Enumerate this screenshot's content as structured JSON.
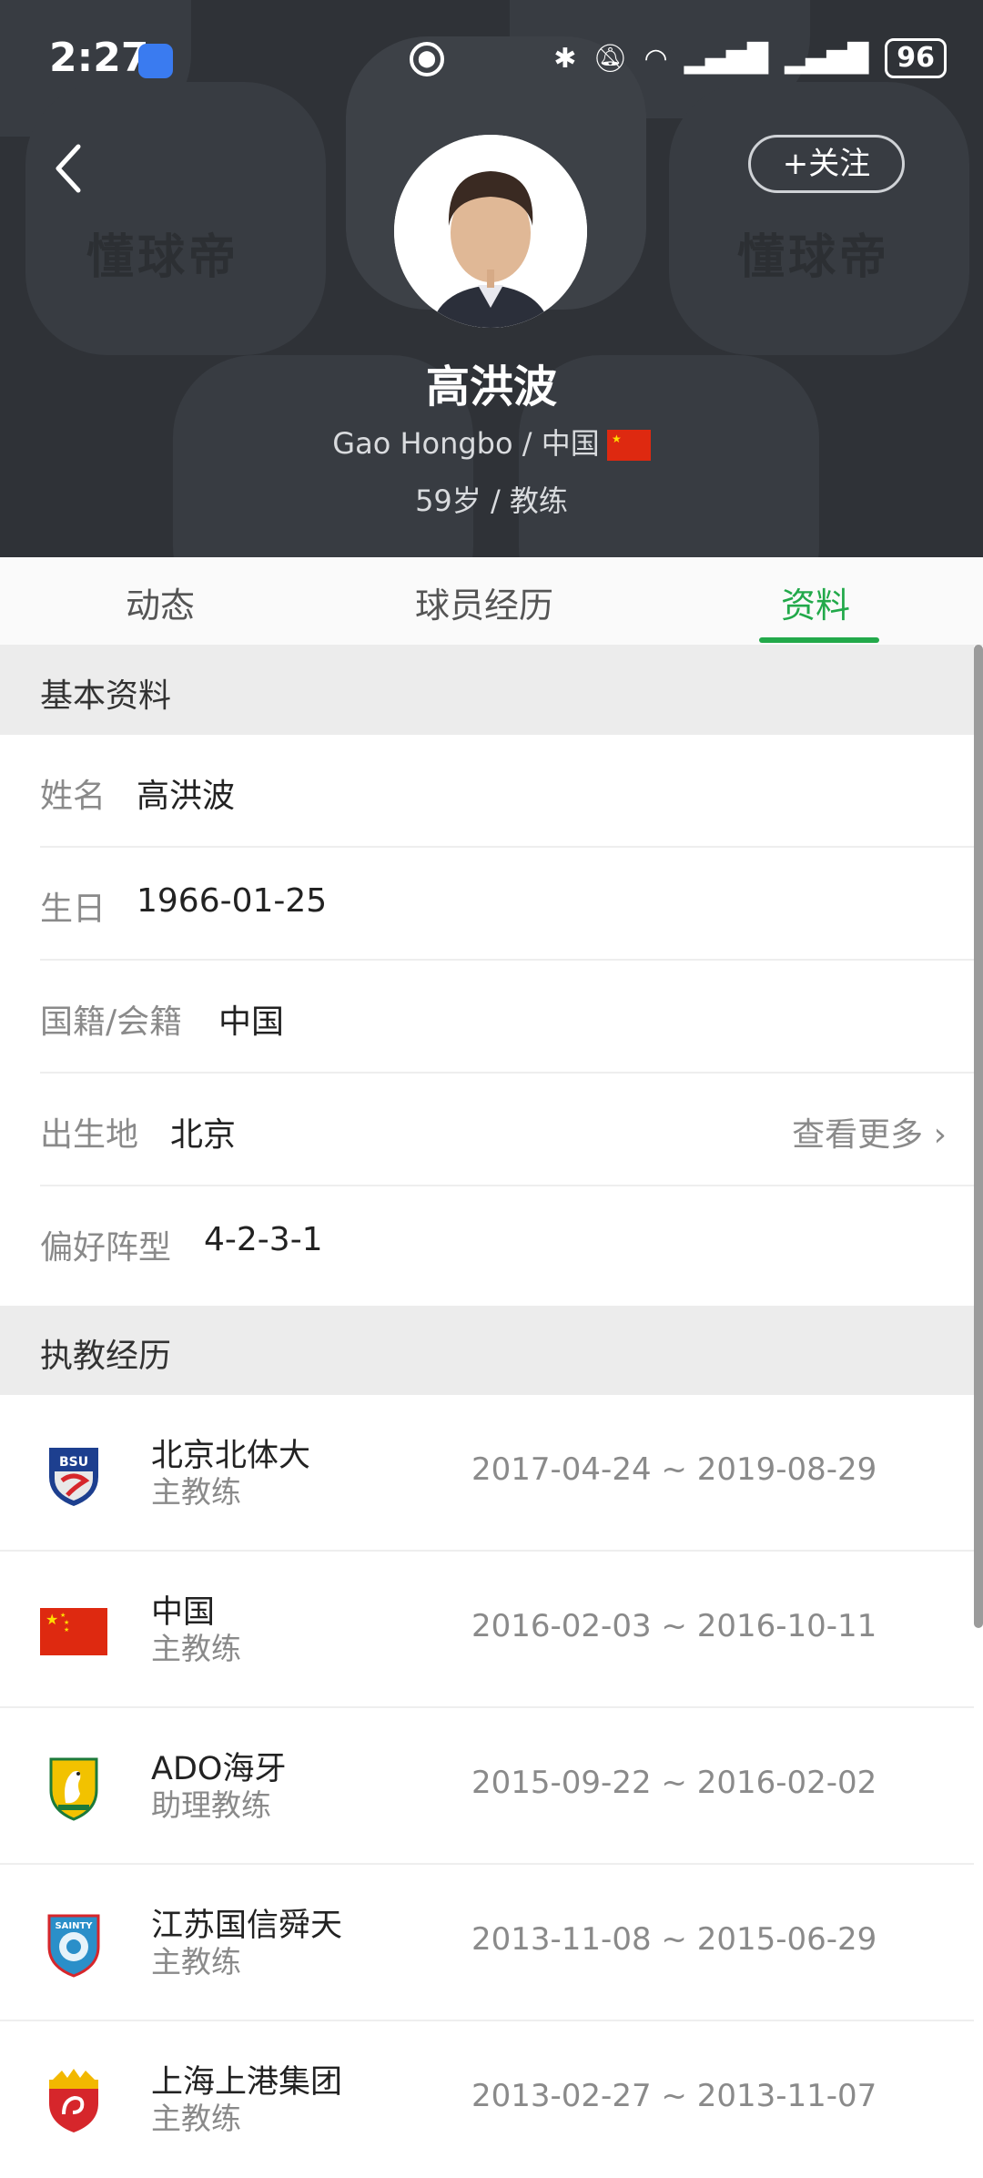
{
  "status_bar": {
    "time": "2:27",
    "battery": "96"
  },
  "header": {
    "follow_label": "+关注",
    "watermark": "懂球帝",
    "name": "高洪波",
    "subtitle": "Gao Hongbo / 中国",
    "meta": "59岁 / 教练"
  },
  "tabs": [
    {
      "label": "动态"
    },
    {
      "label": "球员经历"
    },
    {
      "label": "资料",
      "active": true
    }
  ],
  "basic_info": {
    "section_title": "基本资料",
    "rows": [
      {
        "label": "姓名",
        "value": "高洪波"
      },
      {
        "label": "生日",
        "value": "1966-01-25"
      },
      {
        "label": "国籍/会籍",
        "value": "中国"
      },
      {
        "label": "出生地",
        "value": "北京",
        "more": "查看更多"
      },
      {
        "label": "偏好阵型",
        "value": "4-2-3-1"
      }
    ]
  },
  "coaching": {
    "section_title": "执教经历",
    "items": [
      {
        "team": "北京北体大",
        "role": "主教练",
        "dates": "2017-04-24 ~ 2019-08-29",
        "logo": "bsu-logo",
        "logo_text": "BSU"
      },
      {
        "team": "中国",
        "role": "主教练",
        "dates": "2016-02-03 ~ 2016-10-11",
        "logo": "china-flag"
      },
      {
        "team": "ADO海牙",
        "role": "助理教练",
        "dates": "2015-09-22 ~ 2016-02-02",
        "logo": "ado-logo"
      },
      {
        "team": "江苏国信舜天",
        "role": "主教练",
        "dates": "2013-11-08 ~ 2015-06-29",
        "logo": "sainty-logo",
        "logo_text": "SAINTY"
      },
      {
        "team": "上海上港集团",
        "role": "主教练",
        "dates": "2013-02-27 ~ 2013-11-07",
        "logo": "sipg-logo"
      }
    ]
  },
  "colors": {
    "accent": "#22a94a",
    "header_bg": "#2f3237"
  }
}
